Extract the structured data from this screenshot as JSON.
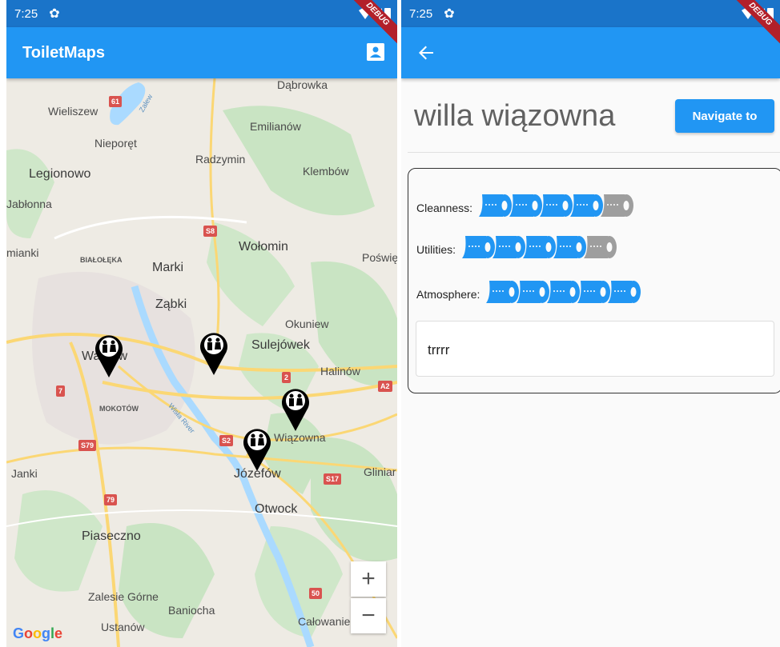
{
  "status": {
    "time": "7:25"
  },
  "debug_label": "DEBUG",
  "left_screen": {
    "app_title": "ToiletMaps",
    "map": {
      "labels": {
        "dabrowka": "Dąbrowka",
        "wieliszew": "Wieliszew",
        "emilianow": "Emilianów",
        "nieporet": "Nieporęt",
        "radzymin": "Radzymin",
        "legionowo": "Legionowo",
        "klembow": "Klembów",
        "jablonna": "Jabłonna",
        "mianki": "mianki",
        "bialoleka": "BIAŁOŁĘKA",
        "wolomin": "Wołomin",
        "poswie": "Poświę",
        "marki": "Marki",
        "zabki": "Ząbki",
        "okuniew": "Okuniew",
        "warsaw": "Warsaw",
        "sulejowek": "Sulejówek",
        "halinow": "Halinów",
        "mokotow": "MOKOTÓW",
        "wisla": "Wisła River",
        "wiazowna": "Wiązowna",
        "janki": "Janki",
        "jozefow": "Józefów",
        "glinia": "Gliniar",
        "otwock": "Otwock",
        "piaseczno": "Piaseczno",
        "zalesie": "Zalesie Górne",
        "baniocha": "Baniocha",
        "ustanow": "Ustanów",
        "calowanie": "Całowanie",
        "zalew": "Zalew"
      },
      "shields": [
        "61",
        "S8",
        "7",
        "S79",
        "2",
        "A2",
        "S2",
        "S17",
        "79",
        "50"
      ],
      "zoom_in": "+",
      "zoom_out": "−",
      "attribution": "Google"
    }
  },
  "right_screen": {
    "place_name": "willa wiązowna",
    "navigate_label": "Navigate to",
    "ratings": [
      {
        "label": "Cleanness:",
        "value": 4,
        "max": 5
      },
      {
        "label": "Utilities:",
        "value": 4,
        "max": 5
      },
      {
        "label": "Atmosphere:",
        "value": 5,
        "max": 5
      }
    ],
    "comment": "trrrr"
  },
  "colors": {
    "primary": "#2196f3",
    "status_bar": "#1a74c9",
    "roll_active": "#2196f3",
    "roll_inactive": "#9e9e9e",
    "debug_banner": "#b2202a"
  },
  "icons": [
    "gear-icon",
    "wifi-icon",
    "signal-icon",
    "battery-icon",
    "account-box-icon",
    "back-arrow-icon",
    "toilet-marker-icon",
    "toilet-roll-icon"
  ]
}
